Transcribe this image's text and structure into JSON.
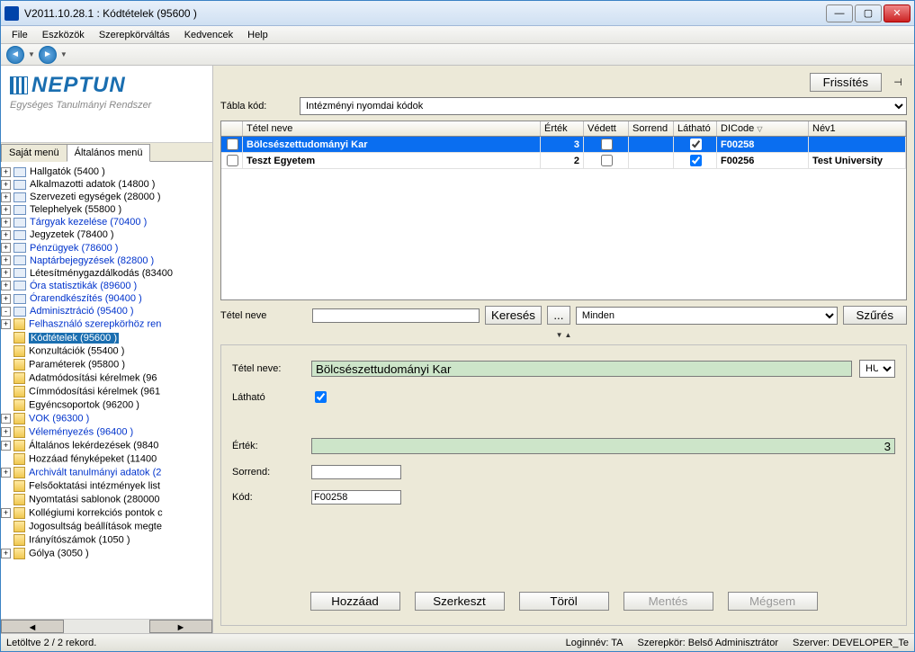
{
  "window": {
    "title": "V2011.10.28.1 : Kódtételek (95600  )"
  },
  "menubar": [
    "File",
    "Eszközök",
    "Szerepkörváltás",
    "Kedvencek",
    "Help"
  ],
  "logo": {
    "main": "NEPTUN",
    "sub": "Egységes Tanulmányi Rendszer"
  },
  "sidetabs": {
    "left": "Saját menü",
    "right": "Általános menü"
  },
  "tree": [
    {
      "label": "Hallgatók (5400  )",
      "lvl": 1,
      "blue": false,
      "exp": "+",
      "icon": "folder-sp"
    },
    {
      "label": "Alkalmazotti adatok (14800  )",
      "lvl": 1,
      "blue": false,
      "exp": "+",
      "icon": "folder-sp"
    },
    {
      "label": "Szervezeti egységek (28000  )",
      "lvl": 1,
      "blue": false,
      "exp": "+",
      "icon": "folder-sp"
    },
    {
      "label": "Telephelyek (55800  )",
      "lvl": 1,
      "blue": false,
      "exp": "+",
      "icon": "folder-sp"
    },
    {
      "label": "Tárgyak kezelése (70400  )",
      "lvl": 1,
      "blue": true,
      "exp": "+",
      "icon": "folder-sp"
    },
    {
      "label": "Jegyzetek (78400  )",
      "lvl": 1,
      "blue": false,
      "exp": "+",
      "icon": "folder-sp"
    },
    {
      "label": "Pénzügyek (78600  )",
      "lvl": 1,
      "blue": true,
      "exp": "+",
      "icon": "folder-sp"
    },
    {
      "label": "Naptárbejegyzések (82800  )",
      "lvl": 1,
      "blue": true,
      "exp": "+",
      "icon": "folder-sp"
    },
    {
      "label": "Létesítménygazdálkodás (83400",
      "lvl": 1,
      "blue": false,
      "exp": "+",
      "icon": "folder-sp"
    },
    {
      "label": "Óra statisztikák (89600  )",
      "lvl": 1,
      "blue": true,
      "exp": "+",
      "icon": "folder-sp"
    },
    {
      "label": "Órarendkészítés (90400  )",
      "lvl": 1,
      "blue": true,
      "exp": "+",
      "icon": "folder-sp"
    },
    {
      "label": "Adminisztráció (95400  )",
      "lvl": 1,
      "blue": true,
      "exp": "-",
      "icon": "folder-sp"
    },
    {
      "label": "Felhasználó szerepkörhöz ren",
      "lvl": 2,
      "blue": true,
      "exp": "+",
      "icon": "doc"
    },
    {
      "label": "Kódtételek (95600  )",
      "lvl": 2,
      "blue": true,
      "exp": "",
      "icon": "doc",
      "selected": true
    },
    {
      "label": "Konzultációk (55400  )",
      "lvl": 2,
      "blue": false,
      "exp": "",
      "icon": "doc"
    },
    {
      "label": "Paraméterek (95800  )",
      "lvl": 2,
      "blue": false,
      "exp": "",
      "icon": "doc"
    },
    {
      "label": "Adatmódosítási kérelmek (96",
      "lvl": 2,
      "blue": false,
      "exp": "",
      "icon": "doc"
    },
    {
      "label": "Címmódosítási kérelmek (961",
      "lvl": 2,
      "blue": false,
      "exp": "",
      "icon": "doc"
    },
    {
      "label": "Egyéncsoportok (96200  )",
      "lvl": 2,
      "blue": false,
      "exp": "",
      "icon": "doc"
    },
    {
      "label": "VOK (96300  )",
      "lvl": 2,
      "blue": true,
      "exp": "+",
      "icon": "doc"
    },
    {
      "label": "Véleményezés (96400  )",
      "lvl": 2,
      "blue": true,
      "exp": "+",
      "icon": "doc"
    },
    {
      "label": "Általános lekérdezések (9840",
      "lvl": 2,
      "blue": false,
      "exp": "+",
      "icon": "doc"
    },
    {
      "label": "Hozzáad fényképeket (11400",
      "lvl": 2,
      "blue": false,
      "exp": "",
      "icon": "doc"
    },
    {
      "label": "Archivált tanulmányi adatok (2",
      "lvl": 2,
      "blue": true,
      "exp": "+",
      "icon": "doc"
    },
    {
      "label": "Felsőoktatási intézmények list",
      "lvl": 2,
      "blue": false,
      "exp": "",
      "icon": "doc"
    },
    {
      "label": "Nyomtatási sablonok (280000",
      "lvl": 2,
      "blue": false,
      "exp": "",
      "icon": "doc"
    },
    {
      "label": "Kollégiumi korrekciós pontok c",
      "lvl": 2,
      "blue": false,
      "exp": "+",
      "icon": "doc"
    },
    {
      "label": "Jogosultság beállítások megte",
      "lvl": 2,
      "blue": false,
      "exp": "",
      "icon": "doc"
    },
    {
      "label": "Irányítószámok (1050  )",
      "lvl": 2,
      "blue": false,
      "exp": "",
      "icon": "doc"
    },
    {
      "label": "Gólya (3050  )",
      "lvl": 2,
      "blue": false,
      "exp": "+",
      "icon": "doc"
    }
  ],
  "right": {
    "refresh": "Frissítés",
    "tablakod_label": "Tábla kód:",
    "tablakod_value": "Intézményi nyomdai kódok",
    "grid_head": {
      "chk": "",
      "name": "Tétel neve",
      "val": "Érték",
      "prot": "Védett",
      "ord": "Sorrend",
      "vis": "Látható",
      "code": "DICode",
      "n1": "Név1"
    },
    "rows": [
      {
        "chk": false,
        "name": "Bölcsészettudományi Kar",
        "val": "3",
        "prot": false,
        "ord": "",
        "vis": true,
        "code": "F00258",
        "n1": "",
        "sel": true
      },
      {
        "chk": false,
        "name": "Teszt Egyetem",
        "val": "2",
        "prot": false,
        "ord": "",
        "vis": true,
        "code": "F00256",
        "n1": "Test University",
        "sel": false
      }
    ],
    "filter": {
      "label": "Tétel neve",
      "search": "Keresés",
      "all": "Minden",
      "btn": "Szűrés"
    },
    "detail": {
      "name_label": "Tétel neve:",
      "name_value": "Bölcsészettudományi Kar",
      "lang": "HU",
      "vis_label": "Látható",
      "vis": true,
      "val_label": "Érték:",
      "val": "3",
      "ord_label": "Sorrend:",
      "ord": "",
      "code_label": "Kód:",
      "code": "F00258"
    },
    "buttons": {
      "add": "Hozzáad",
      "edit": "Szerkeszt",
      "del": "Töröl",
      "save": "Mentés",
      "cancel": "Mégsem"
    }
  },
  "status": {
    "left": "Letöltve 2 / 2 rekord.",
    "login": "Loginnév: TA",
    "role": "Szerepkör: Belső Adminisztrátor",
    "server": "Szerver: DEVELOPER_Te"
  }
}
